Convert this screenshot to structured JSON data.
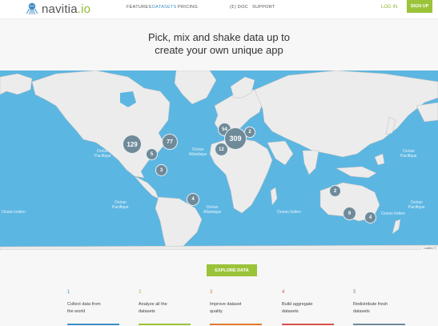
{
  "header": {
    "logo_text": "navitia",
    "logo_suffix": ".io",
    "nav": [
      "FEATURES",
      "DATASETS",
      "PRICING",
      "(Σ) DOC",
      "SUPPORT"
    ],
    "active_nav": "DATASETS",
    "login": "LOG IN",
    "signup": "SIGN UP"
  },
  "headline": {
    "line1": "Pick, mix and shake data up to",
    "line2": "create your own unique app"
  },
  "map": {
    "oceans": [
      {
        "text1": "Océan",
        "text2": "Pacifique"
      },
      {
        "text1": "Océan",
        "text2": "Atlantique"
      },
      {
        "text1": "Océan",
        "text2": "Pacifique"
      },
      {
        "text1": "Océan",
        "text2": "Pacifique"
      },
      {
        "text1": "Océan",
        "text2": "Atlantique"
      },
      {
        "text1": "Océan Indien",
        "text2": ""
      },
      {
        "text1": "Océan",
        "text2": "Pacifique"
      },
      {
        "text1": "Océan Indien",
        "text2": ""
      },
      {
        "text1": "Océan Indien",
        "text2": ""
      }
    ],
    "clusters": [
      "129",
      "77",
      "5",
      "3",
      "4",
      "54",
      "2",
      "309",
      "12",
      "2",
      "9",
      "4"
    ],
    "attribution": "Leaflet | ©"
  },
  "cta": {
    "explore": "EXPLORE DATA"
  },
  "steps": [
    {
      "num": "1",
      "line1": "Collect data from",
      "line2": "the world",
      "color": "#3c8dc5"
    },
    {
      "num": "2",
      "line1": "Analyze all the",
      "line2": "datasets",
      "color": "#9bc33a"
    },
    {
      "num": "3",
      "line1": "Improve dataset",
      "line2": "quality",
      "color": "#e07a2e"
    },
    {
      "num": "4",
      "line1": "Build aggregate",
      "line2": "datasets",
      "color": "#d9534f"
    },
    {
      "num": "5",
      "line1": "Redistribute fresh",
      "line2": "datasets",
      "color": "#6f8a99"
    }
  ]
}
